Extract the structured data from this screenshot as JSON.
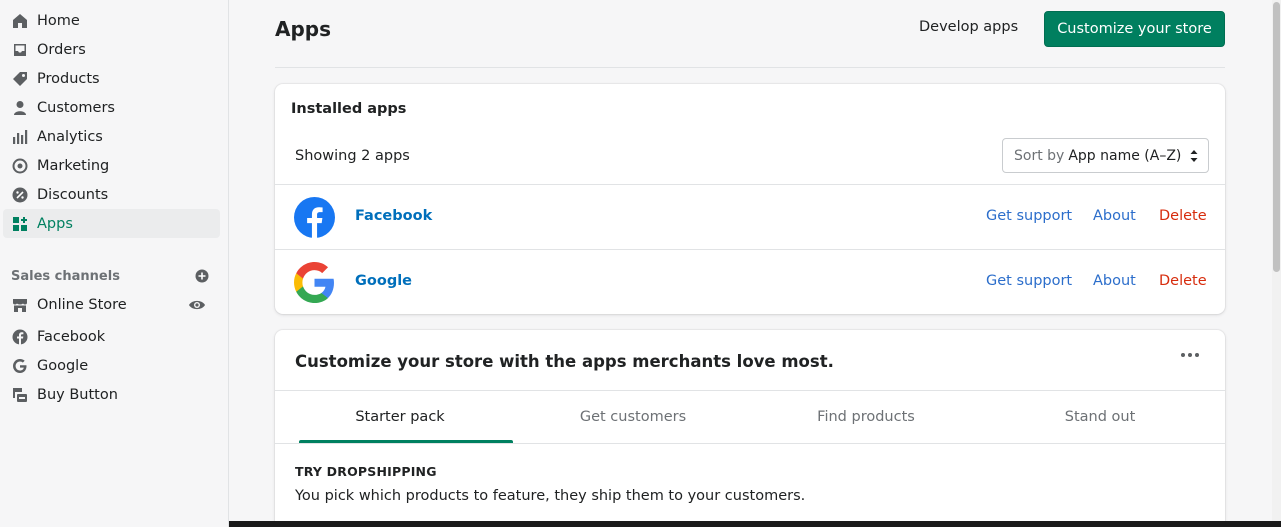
{
  "sidebar": {
    "items": [
      {
        "label": "Home",
        "icon": "home-icon"
      },
      {
        "label": "Orders",
        "icon": "orders-icon"
      },
      {
        "label": "Products",
        "icon": "tag-icon"
      },
      {
        "label": "Customers",
        "icon": "person-icon"
      },
      {
        "label": "Analytics",
        "icon": "bar-chart-icon"
      },
      {
        "label": "Marketing",
        "icon": "target-icon"
      },
      {
        "label": "Discounts",
        "icon": "discount-icon"
      },
      {
        "label": "Apps",
        "icon": "apps-icon",
        "active": true
      }
    ],
    "sales_channels_heading": "Sales channels",
    "channels": [
      {
        "label": "Online Store",
        "icon": "store-icon"
      },
      {
        "label": "Facebook",
        "icon": "facebook-icon"
      },
      {
        "label": "Google",
        "icon": "google-icon"
      },
      {
        "label": "Buy Button",
        "icon": "buy-button-icon"
      }
    ]
  },
  "header": {
    "title": "Apps",
    "develop_label": "Develop apps",
    "customize_label": "Customize your store"
  },
  "installed": {
    "title": "Installed apps",
    "showing": "Showing 2 apps",
    "sort_prefix": "Sort by",
    "sort_value": "App name (A–Z)",
    "apps": [
      {
        "name": "Facebook",
        "support": "Get support",
        "about": "About",
        "delete": "Delete"
      },
      {
        "name": "Google",
        "support": "Get support",
        "about": "About",
        "delete": "Delete"
      }
    ]
  },
  "recommendations": {
    "title": "Customize your store with the apps merchants love most.",
    "tabs": [
      "Starter pack",
      "Get customers",
      "Find products",
      "Stand out"
    ],
    "active_tab": "Starter pack",
    "kicker": "TRY DROPSHIPPING",
    "description": "You pick which products to feature, they ship them to your customers."
  },
  "colors": {
    "primary": "#008060",
    "link": "#2c6ecb",
    "critical": "#d72c0d",
    "facebook": "#1877f2"
  }
}
